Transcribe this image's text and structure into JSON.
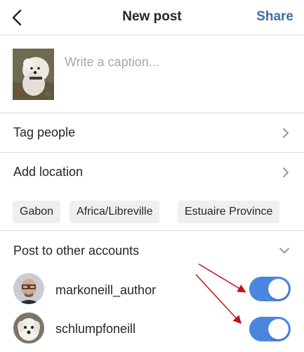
{
  "header": {
    "title": "New post",
    "share_label": "Share",
    "back_icon": "chevron-left-icon"
  },
  "compose": {
    "caption_placeholder": "Write a caption..."
  },
  "rows": {
    "tag_people": "Tag people",
    "add_location": "Add location"
  },
  "location_suggestions": [
    "Gabon",
    "Africa/Libreville",
    "Estuaire Province"
  ],
  "other_accounts": {
    "label": "Post to other accounts",
    "accounts": [
      {
        "name": "markoneill_author",
        "enabled": true
      },
      {
        "name": "schlumpfoneill",
        "enabled": true
      }
    ]
  },
  "colors": {
    "accent": "#3f6fa3",
    "toggle_on": "#4a86e0",
    "annotation_arrow": "#c0141e",
    "divider": "#dbdbdb",
    "placeholder": "#a8a8a8"
  }
}
